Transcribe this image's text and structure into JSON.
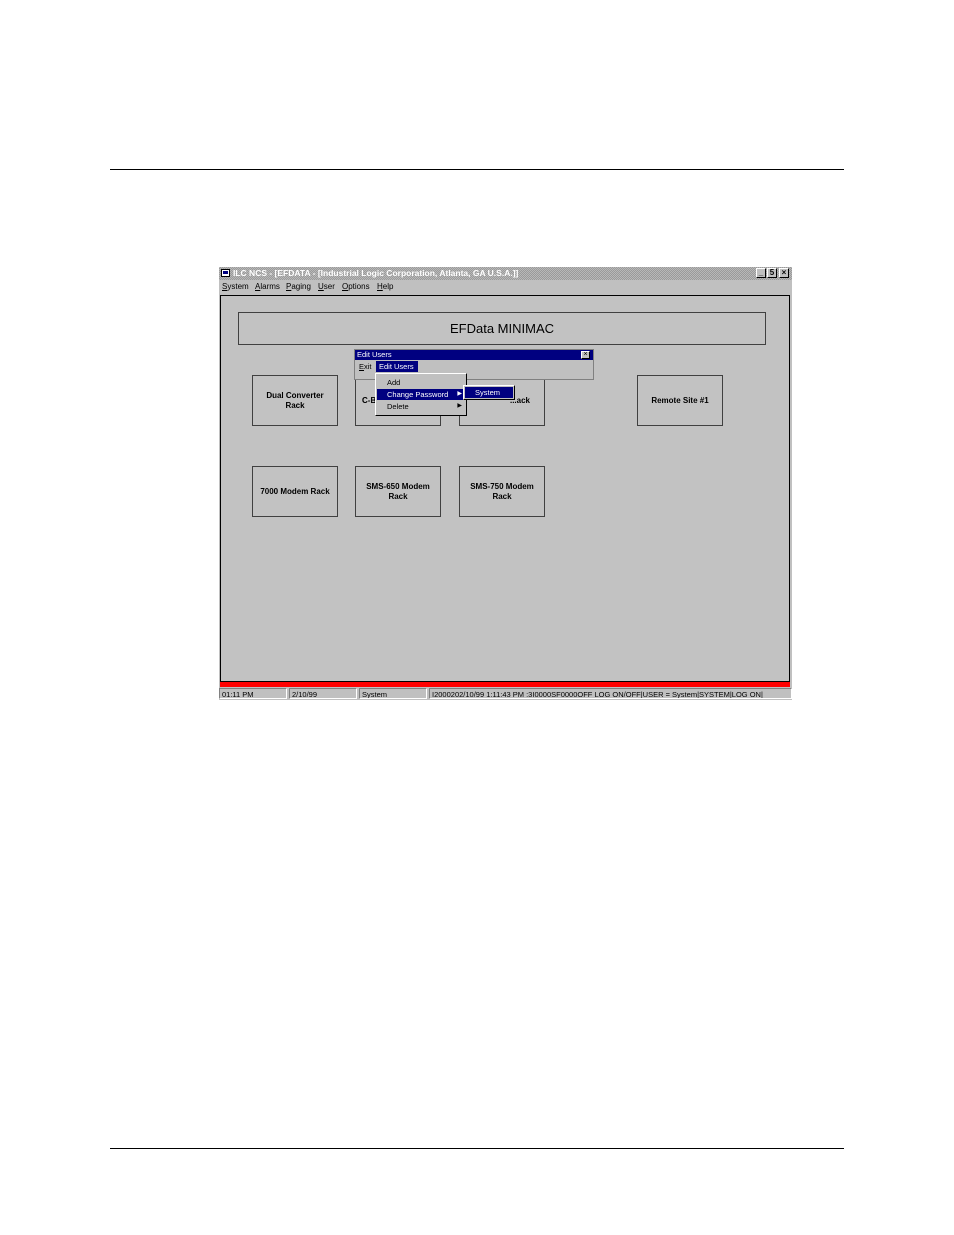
{
  "window": {
    "title": "ILC NCS - [EFDATA - [Industrial Logic Corporation, Atlanta, GA U.S.A.]]",
    "minimize_label": "_",
    "restore_label": "5",
    "close_label": "×"
  },
  "menubar": {
    "items": [
      "System",
      "Alarms",
      "Paging",
      "User",
      "Options",
      "Help"
    ]
  },
  "workspace": {
    "banner": "EFData MINIMAC",
    "racks": [
      "Dual Converter Rack",
      "C-B",
      "...ack",
      "Remote Site #1",
      "7000 Modem Rack",
      "SMS-650 Modem Rack",
      "SMS-750 Modem Rack"
    ]
  },
  "edit_users": {
    "title": "Edit Users",
    "close_label": "×",
    "exit_label": "Exit",
    "active_menu": "Edit Users",
    "dropdown": [
      "Add",
      "Change Password",
      "Delete"
    ],
    "submenu": [
      "System"
    ]
  },
  "status": {
    "time": "01:11 PM",
    "date": "2/10/99",
    "user": "System",
    "log": "I2000202/10/99 1:11:43 PM :3I0000SF0000OFF LOG ON/OFF|USER = System|SYSTEM|LOG ON|"
  },
  "colors": {
    "title_active": "#000080",
    "alarm": "#ff0000",
    "face": "#c0c0c0"
  }
}
